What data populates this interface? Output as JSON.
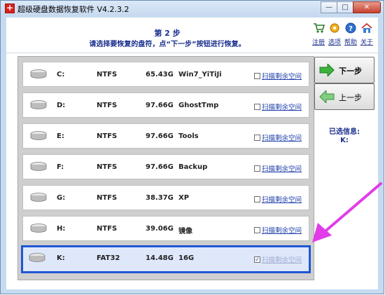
{
  "window": {
    "title": "超级硬盘数据恢复软件 V4.2.3.2",
    "min_label": "—",
    "max_label": "□",
    "close_label": "✕"
  },
  "header": {
    "step_title": "第 2 步",
    "step_hint": "请选择要恢复的盘符，点“下一步”按钮进行恢复。"
  },
  "toolbar": {
    "register_label": "注册",
    "options_label": "选项",
    "help_label": "帮助",
    "about_label": "关于"
  },
  "drives": [
    {
      "letter": "C:",
      "fs": "NTFS",
      "size": "65.43G",
      "label": "Win7_YiTiJi",
      "scan_label": "扫描剩余空间",
      "checked": false
    },
    {
      "letter": "D:",
      "fs": "NTFS",
      "size": "97.66G",
      "label": "GhostTmp",
      "scan_label": "扫描剩余空间",
      "checked": false
    },
    {
      "letter": "E:",
      "fs": "NTFS",
      "size": "97.66G",
      "label": "Tools",
      "scan_label": "扫描剩余空间",
      "checked": false
    },
    {
      "letter": "F:",
      "fs": "NTFS",
      "size": "97.66G",
      "label": "Backup",
      "scan_label": "扫描剩余空间",
      "checked": false
    },
    {
      "letter": "G:",
      "fs": "NTFS",
      "size": "38.37G",
      "label": "XP",
      "scan_label": "扫描剩余空间",
      "checked": false
    },
    {
      "letter": "H:",
      "fs": "NTFS",
      "size": "39.06G",
      "label": "镜像",
      "scan_label": "扫描剩余空间",
      "checked": false
    },
    {
      "letter": "K:",
      "fs": "FAT32",
      "size": "14.48G",
      "label": "16G",
      "scan_label": "扫描剩余空间",
      "checked": true
    }
  ],
  "buttons": {
    "next_label": "下一步",
    "prev_label": "上一步"
  },
  "selection": {
    "heading": "已选信息:",
    "value": "K:"
  },
  "colors": {
    "selection_border": "#1f56d6",
    "annotation_arrow": "#e23ce8",
    "next_arrow": "#2fa52f"
  }
}
